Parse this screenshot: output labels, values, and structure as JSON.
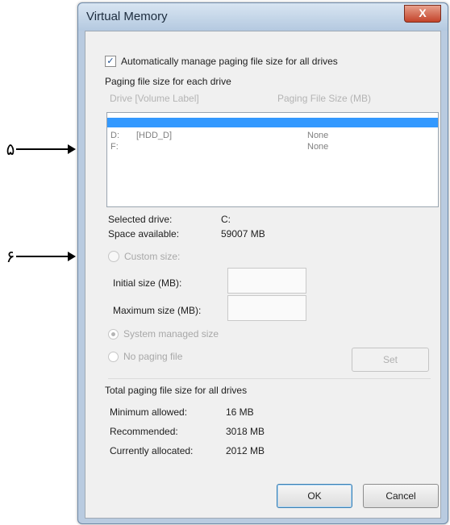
{
  "annotations": [
    "۵",
    "۶"
  ],
  "window": {
    "title": "Virtual Memory",
    "close_label": "X"
  },
  "auto_manage": {
    "label": "Automatically manage paging file size for all drives",
    "checked": true,
    "mark": "✓"
  },
  "paging_section": {
    "heading": "Paging file size for each drive",
    "col_drive": "Drive [Volume Label]",
    "col_size": "Paging File Size (MB)",
    "drives": [
      {
        "drive": "",
        "label": "",
        "size": "",
        "selected": true
      },
      {
        "drive": "D:",
        "label": "[HDD_D]",
        "size": "None",
        "selected": false
      },
      {
        "drive": "F:",
        "label": "",
        "size": "None",
        "selected": false
      }
    ]
  },
  "selected_drive": {
    "label": "Selected drive:",
    "value": "C:"
  },
  "space_available": {
    "label": "Space available:",
    "value": "59007 MB"
  },
  "custom_size": {
    "label": "Custom size:"
  },
  "initial_size": {
    "label": "Initial size (MB):"
  },
  "maximum_size": {
    "label": "Maximum size (MB):"
  },
  "system_managed": {
    "label": "System managed size",
    "checked": true
  },
  "no_paging": {
    "label": "No paging file"
  },
  "set_button": "Set",
  "totals": {
    "heading": "Total paging file size for all drives",
    "minimum_label": "Minimum allowed:",
    "minimum_value": "16 MB",
    "recommended_label": "Recommended:",
    "recommended_value": "3018 MB",
    "allocated_label": "Currently allocated:",
    "allocated_value": "2012 MB"
  },
  "ok_button": "OK",
  "cancel_button": "Cancel"
}
